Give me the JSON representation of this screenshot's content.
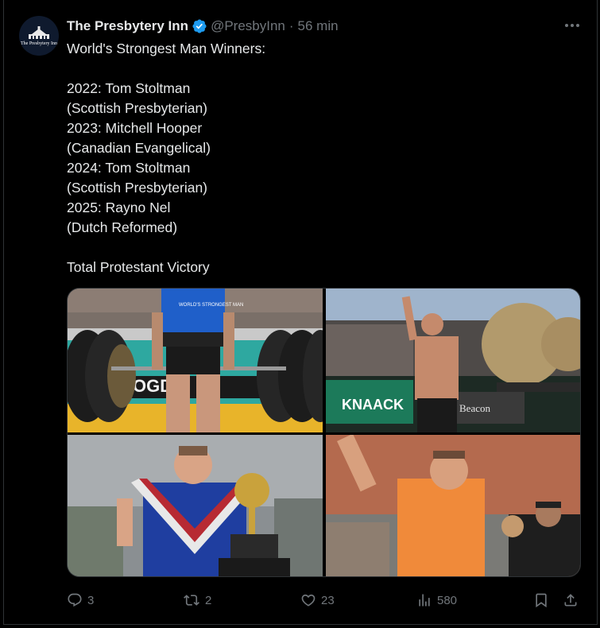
{
  "author": {
    "display_name": "The Presbytery Inn",
    "handle": "@PresbyInn",
    "separator": "·",
    "time": "56 min",
    "avatar_text": "The Presbytery Inn"
  },
  "tweet": {
    "lines": [
      "World's Strongest Man Winners:",
      "",
      "2022: Tom Stoltman",
      "(Scottish Presbyterian)",
      "2023: Mitchell Hooper",
      "(Canadian Evangelical)",
      "2024: Tom Stoltman",
      "(Scottish Presbyterian)",
      "2025: Rayno Nel",
      "(Dutch Reformed)",
      "",
      "Total Protestant Victory"
    ]
  },
  "photo_text": {
    "shirt": "WORLD'S STRONGEST MAN",
    "banner": "KNAACK",
    "beacon": "Beacon",
    "sign": "OGDO"
  },
  "actions": {
    "replies": "3",
    "reposts": "2",
    "likes": "23",
    "views": "580"
  },
  "colors": {
    "verified": "#1d9bf0",
    "muted": "#71767b",
    "text": "#e7e9ea",
    "border": "#2f3336"
  },
  "icons": [
    "verified-badge-icon",
    "more-icon",
    "reply-icon",
    "repost-icon",
    "like-icon",
    "views-icon",
    "bookmark-icon",
    "share-icon"
  ]
}
